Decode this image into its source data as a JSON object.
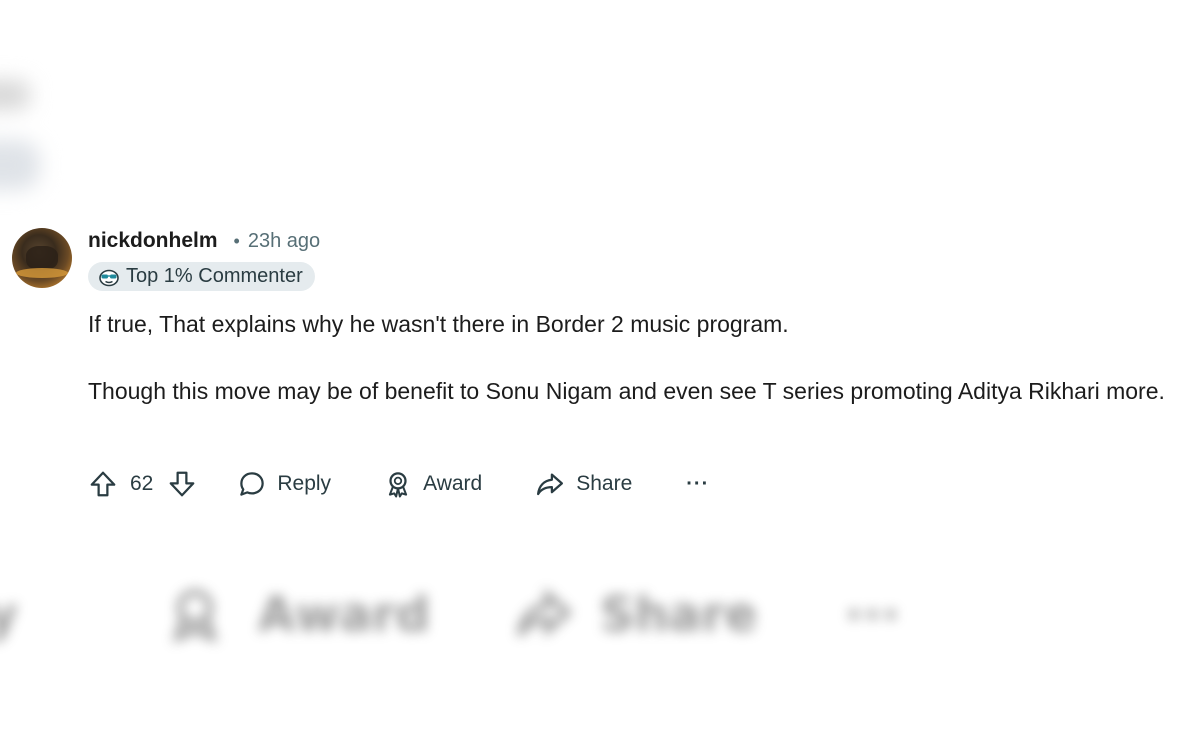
{
  "comment": {
    "author": "nickdonhelm",
    "separator": "•",
    "timestamp": "23h ago",
    "badge": {
      "icon": "sunglasses-snoo-icon",
      "label": "Top 1% Commenter"
    },
    "paragraphs": [
      "If true, That explains why he wasn't there in Border 2 music program.",
      "Though this move may be of benefit to Sonu Nigam and even see T series promoting Aditya Rikhari more."
    ],
    "actions": {
      "upvote_icon": "upvote-arrow-icon",
      "vote_count": "62",
      "downvote_icon": "downvote-arrow-icon",
      "reply_label": "Reply",
      "award_label": "Award",
      "share_label": "Share",
      "more_label": "···"
    }
  },
  "colors": {
    "text_primary": "#1c1c1c",
    "text_secondary": "#576f76",
    "badge_bg": "#e5ebee"
  }
}
